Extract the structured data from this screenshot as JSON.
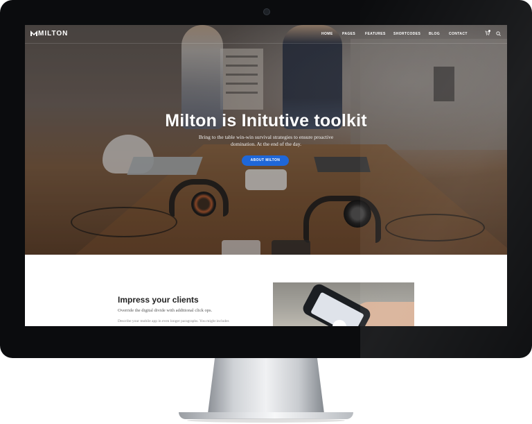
{
  "header": {
    "logo": "MILTON",
    "nav": [
      "HOME",
      "PAGES",
      "FEATURES",
      "SHORTCODES",
      "BLOG",
      "CONTACT"
    ]
  },
  "hero": {
    "title": "Milton is Initutive toolkit",
    "subtitle_line1": "Bring to the table win-win survival strategies to ensure proactive",
    "subtitle_line2": "domination. At the end of the day.",
    "button": "ABOUT MILTON"
  },
  "section": {
    "title": "Impress your clients",
    "subtitle": "Override the digital divide with additional click ops.",
    "body": "Describe your mobile app in even longer paragraphs. You might includes"
  },
  "icons": {
    "cart": "cart-icon",
    "search": "search-icon",
    "camera": "webcam"
  },
  "colors": {
    "accent": "#1f67d8",
    "bezel": "#0b0c0e"
  }
}
